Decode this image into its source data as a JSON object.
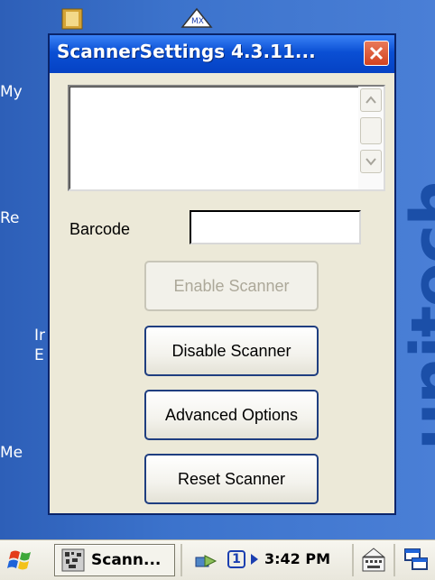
{
  "window": {
    "title": "ScannerSettings 4.3.11...",
    "close_icon": "close-icon"
  },
  "form": {
    "barcode_label": "Barcode",
    "barcode_value": ""
  },
  "buttons": {
    "enable": "Enable Scanner",
    "disable": "Disable Scanner",
    "advanced": "Advanced Options",
    "reset": "Reset Scanner"
  },
  "desktop": {
    "labels": [
      "My",
      "Re",
      "Ir",
      "E",
      "Me"
    ],
    "brand": "unitech"
  },
  "taskbar": {
    "task_label": "Scann...",
    "notification_number": "1",
    "time": "3:42 PM"
  },
  "colors": {
    "titlebar": "#0a4fd4",
    "close": "#d3431f",
    "desktop": "#3a6ec4"
  }
}
